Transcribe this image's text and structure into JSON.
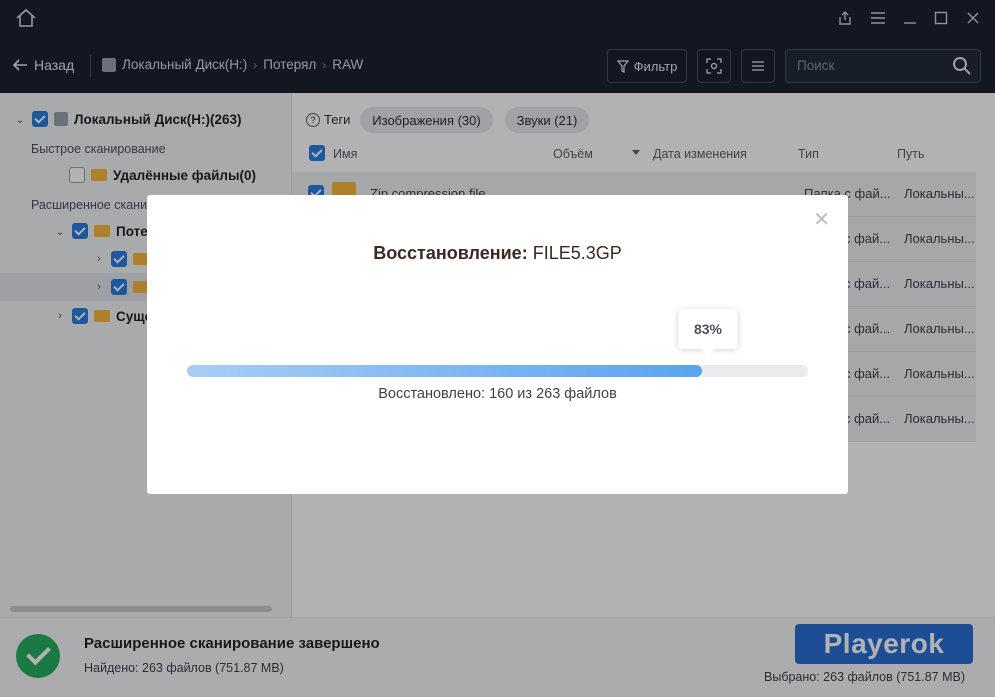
{
  "header": {
    "back_label": "Назад",
    "breadcrumbs": [
      "Локальный Диск(H:)",
      "Потерял",
      "RAW"
    ],
    "filter_label": "Фильтр",
    "search_placeholder": "Поиск"
  },
  "sidebar": {
    "root_label": "Локальный Диск(H:)(263)",
    "quick_scan_label": "Быстрое сканирование",
    "deleted_files_label": "Удалённые файлы(0)",
    "advanced_scan_label": "Расширенное скани",
    "lost_label": "Потер",
    "existing_label": "Суще"
  },
  "tags": {
    "label": "Теги",
    "images": "Изображения (30)",
    "sounds": "Звуки (21)"
  },
  "columns": {
    "name": "Имя",
    "size": "Объём",
    "date": "Дата изменения",
    "type": "Тип",
    "path": "Путь"
  },
  "rows": [
    {
      "name": "Zip compression file",
      "type": "Папка с фай...",
      "path": "Локальны..."
    },
    {
      "name": "",
      "type": "с фай...",
      "path": "Локальны..."
    },
    {
      "name": "",
      "type": "с фай...",
      "path": "Локальны..."
    },
    {
      "name": "",
      "type": "с фай...",
      "path": "Локальны..."
    },
    {
      "name": "",
      "type": "с фай...",
      "path": "Локальны..."
    },
    {
      "name": "",
      "type": "с фай...",
      "path": "Локальны..."
    }
  ],
  "footer": {
    "title": "Расширенное сканирование завершено",
    "found": "Найдено: 263 файлов (751.87 MB)",
    "recover_button": "Playerok",
    "selected": "Выбрано: 263 файлов   (751.87 MB)"
  },
  "modal": {
    "title_bold": "Восстановление:",
    "file_name": "FILE5.3GP",
    "progress_label": "83%",
    "progress_value": 0.83,
    "recovered_text": "Восстановлено: 160 из 263 файлов"
  },
  "colors": {
    "accent": "#2a7de1",
    "success": "#27ae60",
    "titlebar": "#1b2230"
  }
}
